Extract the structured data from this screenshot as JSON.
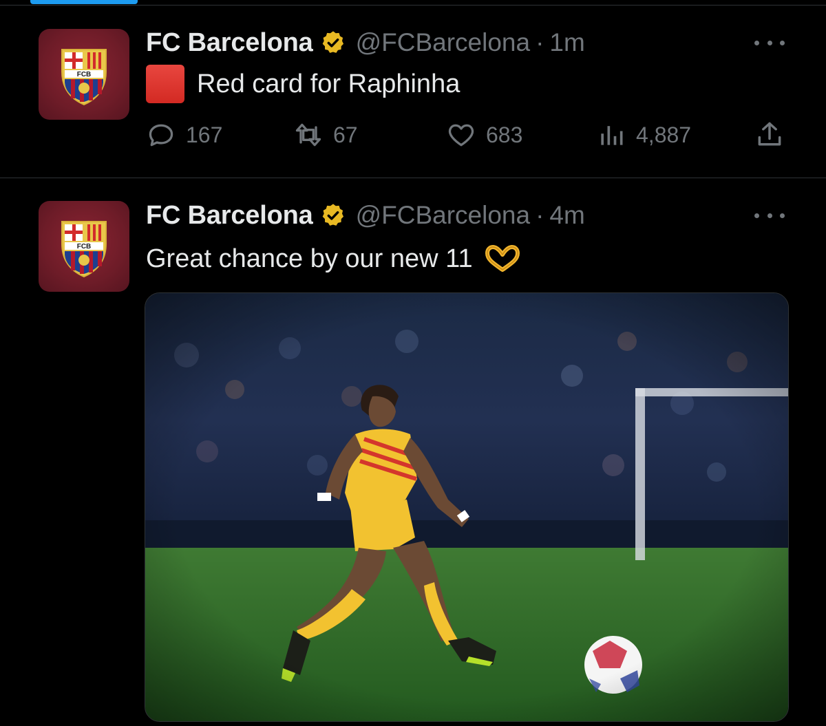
{
  "tweets": [
    {
      "display_name": "FC Barcelona",
      "handle": "@FCBarcelona",
      "separator": "·",
      "time": "1m",
      "text": "Red card for Raphinha",
      "emoji": "red-square",
      "replies": "167",
      "reposts": "67",
      "likes": "683",
      "views": "4,887"
    },
    {
      "display_name": "FC Barcelona",
      "handle": "@FCBarcelona",
      "separator": "·",
      "time": "4m",
      "text": "Great chance by our new 11",
      "emoji": "heart-hands",
      "media": "player-photo"
    }
  ],
  "avatar_crest_text": "FCB",
  "colors": {
    "background": "#000000",
    "text": "#e7e9ea",
    "muted": "#71767b",
    "divider": "#2f3336",
    "accent": "#1d9bf0",
    "verified_gold": "#e8b923",
    "avatar_bg": "#6e1c28",
    "kit_yellow": "#f2c230",
    "pitch_green": "#2f6b2a"
  },
  "icons": [
    "reply-icon",
    "repost-icon",
    "like-icon",
    "views-icon",
    "share-icon",
    "more-icon",
    "verified-badge-icon"
  ]
}
